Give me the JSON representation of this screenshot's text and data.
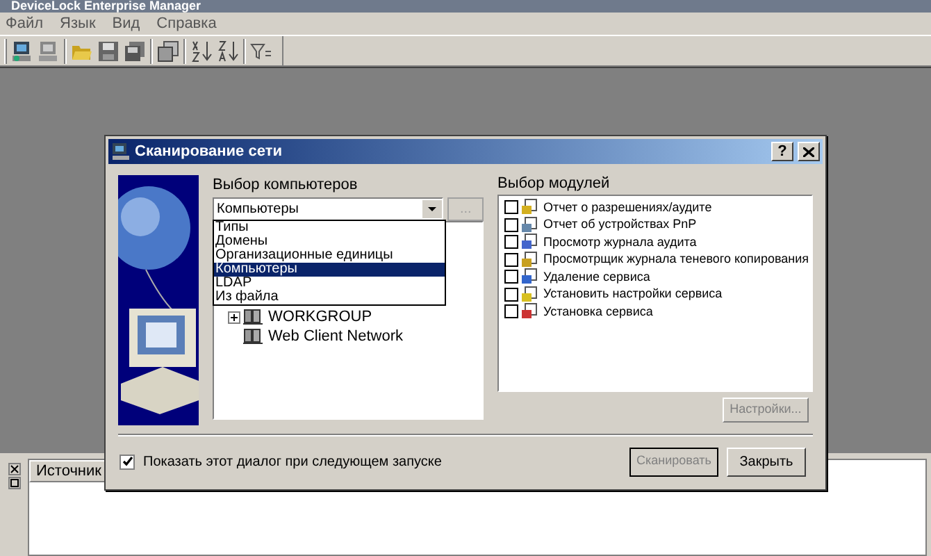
{
  "app": {
    "title": "DeviceLock Enterprise Manager",
    "menu": [
      "Файл",
      "Язык",
      "Вид",
      "Справка"
    ]
  },
  "dialog": {
    "title": "Сканирование сети",
    "help_button": "?",
    "computers_label": "Выбор компьютеров",
    "combo_value": "Компьютеры",
    "browse_button": "...",
    "dropdown": [
      {
        "label": "Типы",
        "selected": false
      },
      {
        "label": "Домены",
        "selected": false
      },
      {
        "label": "Организационные единицы",
        "selected": false
      },
      {
        "label": "Компьютеры",
        "selected": true
      },
      {
        "label": "LDAP",
        "selected": false
      },
      {
        "label": "Из файла",
        "selected": false
      }
    ],
    "tree": [
      {
        "label": "WORKGROUP",
        "expanded": false
      },
      {
        "label": "Web Client Network"
      }
    ],
    "modules_label": "Выбор модулей",
    "modules": [
      {
        "label": "Отчет о разрешениях/аудите",
        "checked": false
      },
      {
        "label": "Отчет об устройствах PnP",
        "checked": false
      },
      {
        "label": "Просмотр журнала аудита",
        "checked": false
      },
      {
        "label": "Просмотрщик журнала теневого копирования",
        "checked": false
      },
      {
        "label": "Удаление сервиса",
        "checked": false
      },
      {
        "label": "Установить настройки сервиса",
        "checked": false
      },
      {
        "label": "Установка сервиса",
        "checked": false
      }
    ],
    "settings_button": {
      "label": "Настройки...",
      "disabled": true
    },
    "show_dialog": {
      "label": "Показать этот диалог при следующем запуске",
      "checked": true
    },
    "scan_button": {
      "label": "Сканировать",
      "disabled": true
    },
    "close_button": "Закрыть"
  },
  "bottom_panel": {
    "columns": [
      "Источник"
    ]
  }
}
